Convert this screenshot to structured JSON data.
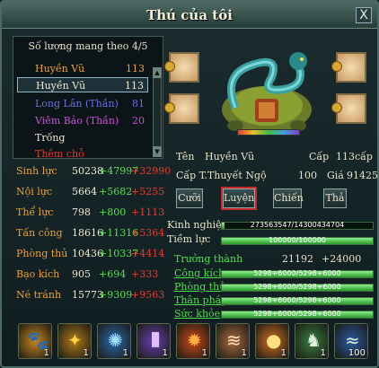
{
  "window": {
    "title": "Thú của tôi",
    "close_label": "X"
  },
  "pet_list": {
    "header": "Số lượng mang theo 4/5",
    "items": [
      {
        "name": "Huyền Vũ",
        "level": "113",
        "color": "#f0a030"
      },
      {
        "name": "Huyền Vũ",
        "level": "113",
        "color": "#f0e8d0"
      },
      {
        "name": "Long Lân (Thần)",
        "level": "81",
        "color": "#6a70e8"
      },
      {
        "name": "Viêm Bảo (Thần)",
        "level": "20",
        "color": "#c850d8"
      },
      {
        "name": "Trống",
        "level": "",
        "color": "#f0e8d0"
      },
      {
        "name": "Thêm chỗ",
        "level": "",
        "color": "#e83a30"
      }
    ]
  },
  "stats": [
    {
      "label": "Sinh lực",
      "base": "50238",
      "bonus": "+47997",
      "extra": "+32990"
    },
    {
      "label": "Nội lực",
      "base": "5664",
      "bonus": "+5682",
      "extra": "+5255"
    },
    {
      "label": "Thể lực",
      "base": "798",
      "bonus": "+800",
      "extra": "+1113"
    },
    {
      "label": "Tấn công",
      "base": "18616",
      "bonus": "+11316",
      "extra": "+5364"
    },
    {
      "label": "Phòng thủ",
      "base": "10436",
      "bonus": "+10337",
      "extra": "+4414"
    },
    {
      "label": "Bạo kích",
      "base": "905",
      "bonus": "+694",
      "extra": "+333"
    },
    {
      "label": "Né tránh",
      "base": "15773",
      "bonus": "+9309",
      "extra": "+9563"
    }
  ],
  "info": {
    "name_label": "Tên",
    "name": "Huyền Vũ",
    "level_label": "Cấp",
    "level": "113cấp",
    "tier_label": "Cấp T.Thuyết Ngộ",
    "tier": "100",
    "price_label": "Giá",
    "price": "91425"
  },
  "actions": {
    "ride": "Cưỡi",
    "train": "Luyện",
    "fight": "Chiến",
    "release": "Thả"
  },
  "progress": {
    "exp_label": "Kinh nghiệm",
    "exp_text": "273563547/14300434704",
    "exp_fraction": 0.02,
    "pot_label": "Tiềm lực",
    "pot_text": "100000/100000",
    "pot_fraction": 1.0,
    "growth_label": "Trưởng thành",
    "growth_value": "21192",
    "growth_bonus": "+24000"
  },
  "attributes": [
    {
      "label": "Công kích",
      "value": "5298+6000/5298+6000",
      "fraction": 1.0
    },
    {
      "label": "Phòng thủ",
      "value": "5298+6000/5298+6000",
      "fraction": 1.0
    },
    {
      "label": "Thân pháp",
      "value": "5298+6000/5298+6000",
      "fraction": 1.0
    },
    {
      "label": "Sức khỏe",
      "value": "5298+6000/5298+6000",
      "fraction": 1.0
    }
  ],
  "skills": [
    {
      "icon": "paw-icon",
      "count": "1",
      "color": "#c8861e"
    },
    {
      "icon": "flame-icon",
      "count": "1",
      "color": "#b07a18"
    },
    {
      "icon": "water-icon",
      "count": "1",
      "color": "#2a6ab0"
    },
    {
      "icon": "light-pillar-icon",
      "count": "1",
      "color": "#6a40b0"
    },
    {
      "icon": "fire-icon",
      "count": "1",
      "color": "#c84a18"
    },
    {
      "icon": "claw-icon",
      "count": "1",
      "color": "#a86a40"
    },
    {
      "icon": "orb-icon",
      "count": "1",
      "color": "#d07020"
    },
    {
      "icon": "horse-icon",
      "count": "1",
      "color": "#3a8040"
    },
    {
      "icon": "wave-icon",
      "count": "100",
      "color": "#2a5aa0"
    }
  ]
}
